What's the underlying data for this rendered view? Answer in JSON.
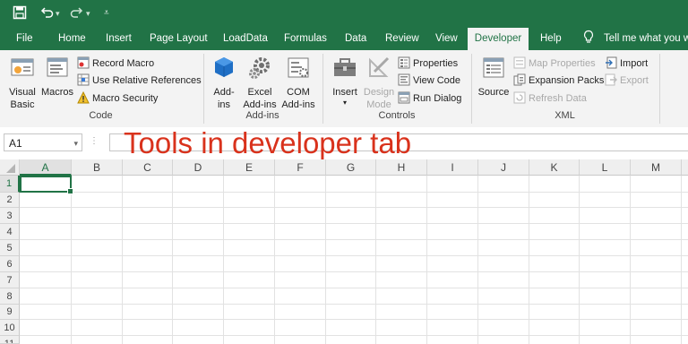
{
  "qat": {
    "save_icon": "save-icon",
    "undo_icon": "undo-icon",
    "redo_icon": "redo-icon",
    "customize_icon": "customize-qat-icon"
  },
  "tabs": [
    {
      "label": "File"
    },
    {
      "label": "Home"
    },
    {
      "label": "Insert"
    },
    {
      "label": "Page Layout"
    },
    {
      "label": "LoadData"
    },
    {
      "label": "Formulas"
    },
    {
      "label": "Data"
    },
    {
      "label": "Review"
    },
    {
      "label": "View"
    },
    {
      "label": "Developer"
    },
    {
      "label": "Help"
    }
  ],
  "active_tab": "Developer",
  "tell_me": "Tell me what you wa",
  "ribbon": {
    "code": {
      "label": "Code",
      "visual_basic": "Visual\nBasic",
      "macros": "Macros",
      "record_macro": "Record Macro",
      "use_relative": "Use Relative References",
      "macro_security": "Macro Security"
    },
    "addins": {
      "label": "Add-ins",
      "addins": "Add-\nins",
      "excel_addins": "Excel\nAdd-ins",
      "com_addins": "COM\nAdd-ins"
    },
    "controls": {
      "label": "Controls",
      "insert": "Insert",
      "design_mode": "Design\nMode",
      "properties": "Properties",
      "view_code": "View Code",
      "run_dialog": "Run Dialog"
    },
    "xml": {
      "label": "XML",
      "source": "Source",
      "map_properties": "Map Properties",
      "expansion_packs": "Expansion Packs",
      "refresh_data": "Refresh Data",
      "import": "Import",
      "export": "Export"
    }
  },
  "name_box": "A1",
  "overlay_title": "Tools in developer tab",
  "columns": [
    "A",
    "B",
    "C",
    "D",
    "E",
    "F",
    "G",
    "H",
    "I",
    "J",
    "K",
    "L",
    "M"
  ],
  "rows": [
    "1",
    "2",
    "3",
    "4",
    "5",
    "6",
    "7",
    "8",
    "9",
    "10",
    "11"
  ],
  "colors": {
    "accent": "#217346",
    "overlay_text": "#d9321c"
  }
}
